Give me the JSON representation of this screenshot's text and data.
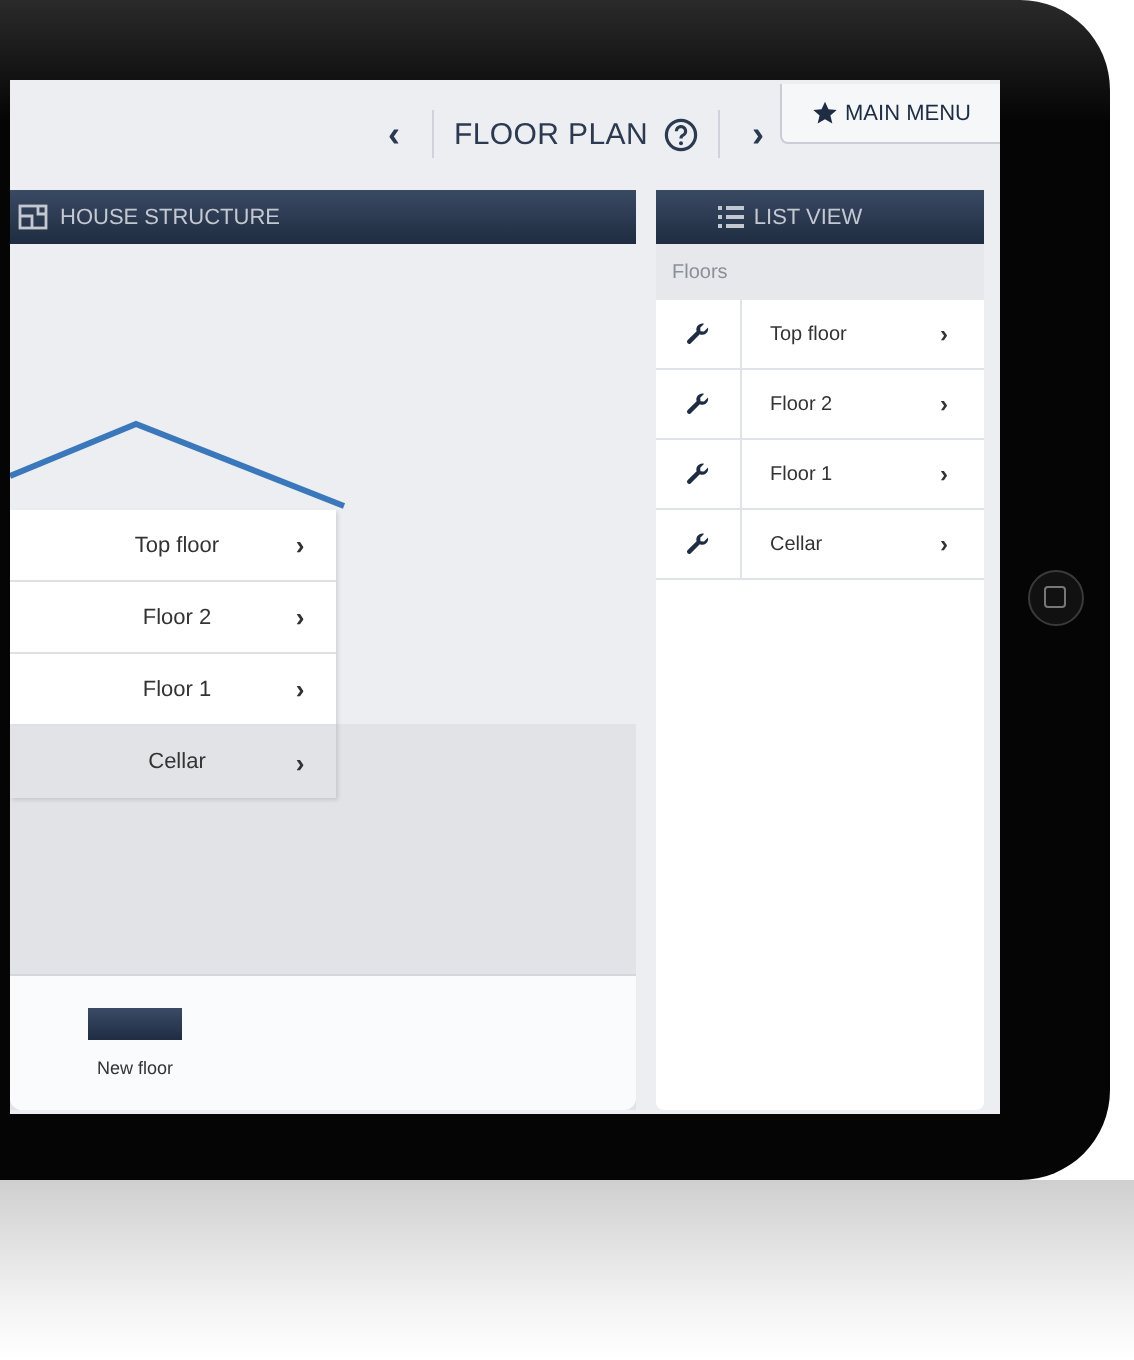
{
  "header": {
    "prev": "‹",
    "title": "FLOOR PLAN",
    "next": "›",
    "main_menu": "MAIN MENU"
  },
  "house_structure": {
    "title": "HOUSE STRUCTURE",
    "floors": [
      {
        "label": "Top floor",
        "chevron": "›",
        "underground": false
      },
      {
        "label": "Floor 2",
        "chevron": "›",
        "underground": false
      },
      {
        "label": "Floor 1",
        "chevron": "›",
        "underground": false
      },
      {
        "label": "Cellar",
        "chevron": "›",
        "underground": true
      }
    ],
    "new_floor": "New floor"
  },
  "list_view": {
    "title": "LIST VIEW",
    "section": "Floors",
    "floors": [
      {
        "label": "Top floor",
        "chevron": "›"
      },
      {
        "label": "Floor 2",
        "chevron": "›"
      },
      {
        "label": "Floor 1",
        "chevron": "›"
      },
      {
        "label": "Cellar",
        "chevron": "›"
      }
    ]
  }
}
